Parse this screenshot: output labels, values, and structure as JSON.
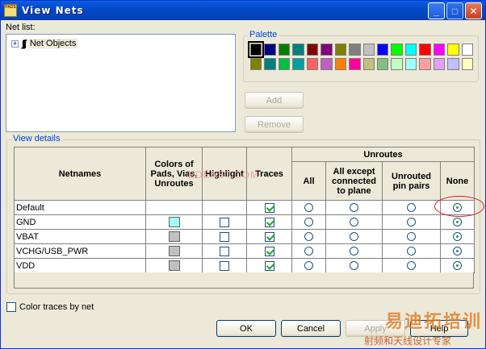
{
  "window": {
    "title": "View Nets",
    "icon_text": "PADS",
    "minimize": "_",
    "maximize": "□",
    "close": "✕"
  },
  "netlist": {
    "label": "Net list:",
    "expander": "+",
    "icon": "∫∫∫",
    "item": "Net Objects"
  },
  "palette": {
    "label": "Palette",
    "row1": [
      "#000000",
      "#000080",
      "#008000",
      "#008080",
      "#800000",
      "#800080",
      "#808000",
      "#808080",
      "#c0c0c0",
      "#0000ff",
      "#00ff00",
      "#00ffff",
      "#ff0000",
      "#ff00ff",
      "#ffff00",
      "#ffffff"
    ],
    "row2": [
      "#808000",
      "#008080",
      "#00c040",
      "#00a0a0",
      "#ff6060",
      "#c060c0",
      "#ff8000",
      "#ff00a0",
      "#c0c080",
      "#80c080",
      "#c0ffc0",
      "#a0ffff",
      "#ffa0a0",
      "#e0a0ff",
      "#c0c0ff",
      "#ffffc0"
    ],
    "selected_index": 0
  },
  "buttons": {
    "add": "Add",
    "remove": "Remove",
    "ok": "OK",
    "cancel": "Cancel",
    "apply": "Apply",
    "help": "Help"
  },
  "view_details": {
    "label": "View details",
    "headers": {
      "netnames": "Netnames",
      "colors": "Colors of Pads, Vias, Unroutes",
      "highlight": "Highlight",
      "traces": "Traces",
      "unroutes": "Unroutes",
      "all": "All",
      "all_except": "All except connected to plane",
      "unrouted_pin_pairs": "Unrouted pin pairs",
      "none": "None"
    },
    "rows": [
      {
        "name": "Default",
        "color": "",
        "highlight": null,
        "traces": true,
        "unroute": "none"
      },
      {
        "name": "GND",
        "color": "#a0ffff",
        "highlight": false,
        "traces": true,
        "unroute": "none"
      },
      {
        "name": "VBAT",
        "color": "#c0c0c0",
        "highlight": false,
        "traces": true,
        "unroute": "none"
      },
      {
        "name": "VCHG/USB_PWR",
        "color": "#c0c0c0",
        "highlight": false,
        "traces": true,
        "unroute": "none"
      },
      {
        "name": "VDD",
        "color": "#c0c0c0",
        "highlight": false,
        "traces": true,
        "unroute": "none"
      }
    ]
  },
  "color_traces_by_net": {
    "label": "Color traces by net",
    "checked": false
  },
  "watermarks": {
    "center": "EDEAST.COM",
    "corner_logo": "易迪拓培训",
    "corner_sub": "射频和天线设计专家"
  }
}
